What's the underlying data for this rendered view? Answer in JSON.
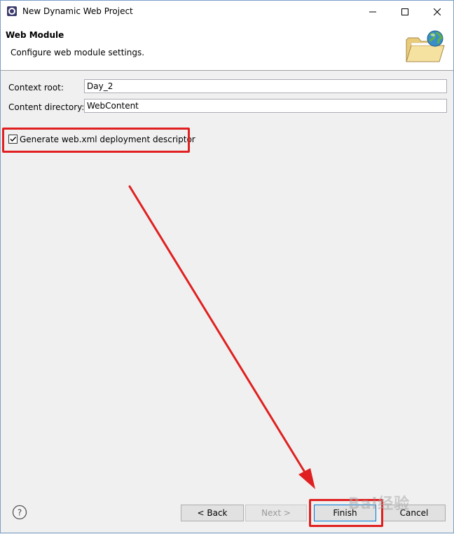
{
  "window": {
    "title": "New Dynamic Web Project",
    "controls": {
      "minimize_icon": "minimize-icon",
      "maximize_icon": "maximize-icon",
      "close_icon": "close-icon"
    }
  },
  "header": {
    "title": "Web Module",
    "description": "Configure web module settings."
  },
  "form": {
    "context_root": {
      "label": "Context root:",
      "value": "Day_2"
    },
    "content_directory": {
      "label": "Content directory:",
      "value": "WebContent"
    },
    "generate_descriptor": {
      "label": "Generate web.xml deployment descriptor",
      "checked": true
    }
  },
  "buttons": {
    "help": "?",
    "back": "< Back",
    "next": "Next >",
    "finish": "Finish",
    "cancel": "Cancel"
  },
  "annotations": {
    "highlight_color": "#e02020"
  },
  "watermark": "Bai经验"
}
